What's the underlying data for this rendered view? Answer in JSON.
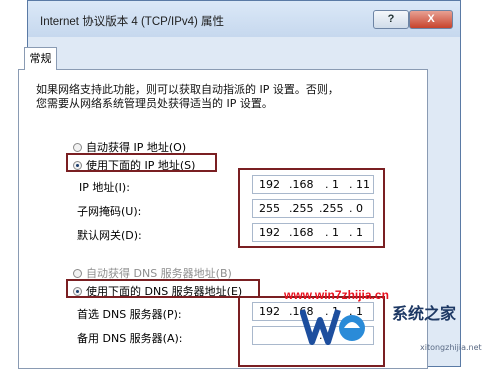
{
  "window": {
    "title": "Internet 协议版本 4 (TCP/IPv4) 属性",
    "help_label": "?",
    "close_label": "X"
  },
  "tab": {
    "label": "常规"
  },
  "description": {
    "line1": "如果网络支持此功能，则可以获取自动指派的 IP 设置。否则，",
    "line2": "您需要从网络系统管理员处获得适当的 IP 设置。"
  },
  "ip_section": {
    "auto_label": "自动获得 IP 地址(O)",
    "manual_label": "使用下面的 IP 地址(S)",
    "fields": [
      {
        "label": "IP 地址(I):",
        "octets": [
          "192",
          ".168",
          ". 1",
          ". 11"
        ]
      },
      {
        "label": "子网掩码(U):",
        "octets": [
          "255",
          ".255",
          ".255",
          ". 0"
        ]
      },
      {
        "label": "默认网关(D):",
        "octets": [
          "192",
          ".168",
          ". 1",
          ". 1"
        ]
      }
    ]
  },
  "dns_section": {
    "auto_label": "自动获得 DNS 服务器地址(B)",
    "manual_label": "使用下面的 DNS 服务器地址(E)",
    "fields": [
      {
        "label": "首选 DNS 服务器(P):",
        "octets": [
          "192",
          ".168",
          ". 1",
          ". 1"
        ]
      },
      {
        "label": "备用 DNS 服务器(A):",
        "octets": [
          "",
          "",
          ".",
          ""
        ]
      }
    ]
  },
  "watermark": {
    "url": "www.win7zhijia.cn",
    "brand": "系统之家",
    "sub": "xitongzhijia.net"
  },
  "colors": {
    "highlight_box": "#7a1f22",
    "watermark_red": "#e8101e"
  }
}
